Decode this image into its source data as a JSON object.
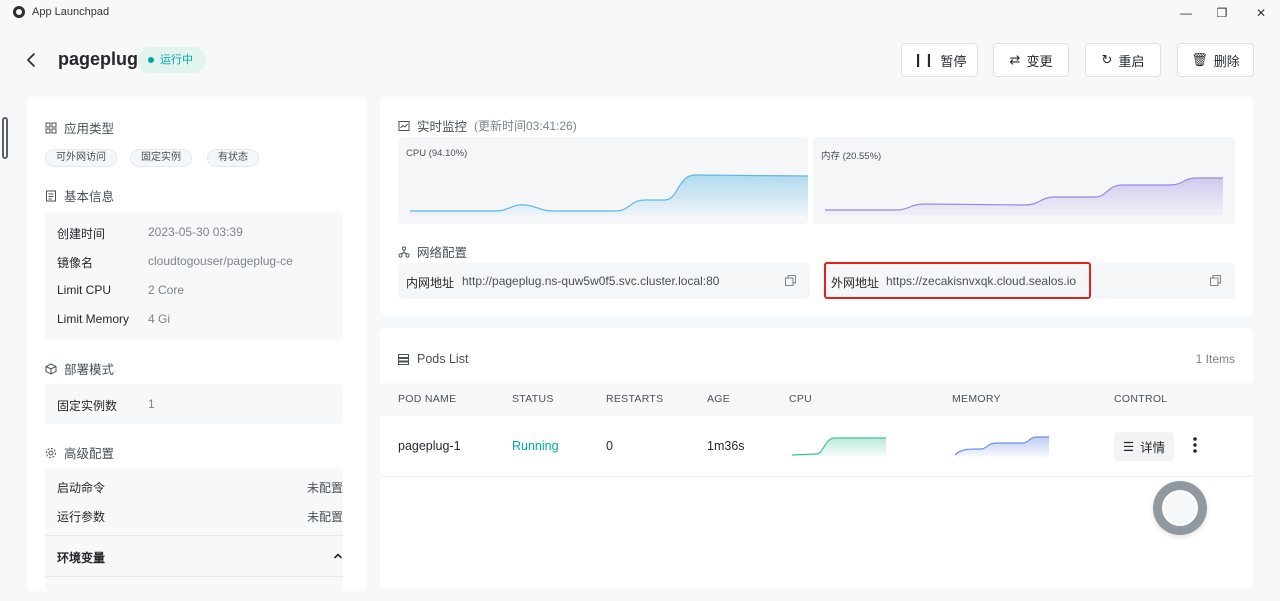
{
  "window": {
    "title": "App Launchpad",
    "minimize_label": "—",
    "maximize_label": "❐",
    "close_label": "✕"
  },
  "header": {
    "app_name": "pageplug",
    "status": "运行中",
    "actions": {
      "pause": "暂停",
      "change": "变更",
      "restart": "重启",
      "delete": "删除"
    }
  },
  "sidebar": {
    "app_type": {
      "title": "应用类型",
      "tags": [
        "可外网访问",
        "固定实例",
        "有状态"
      ]
    },
    "basic": {
      "title": "基本信息",
      "rows": [
        {
          "label": "创建时间",
          "value": "2023-05-30 03:39"
        },
        {
          "label": "镜像名",
          "value": "cloudtogouser/pageplug-ce"
        },
        {
          "label": "Limit CPU",
          "value": "2 Core"
        },
        {
          "label": "Limit Memory",
          "value": "4 Gi"
        }
      ]
    },
    "deploy": {
      "title": "部署模式",
      "label": "固定实例数",
      "value": "1"
    },
    "advanced": {
      "title": "高级配置",
      "rows": [
        {
          "label": "启动命令",
          "value": "未配置"
        },
        {
          "label": "运行参数",
          "value": "未配置"
        }
      ],
      "env_label": "环境变量"
    }
  },
  "monitor": {
    "title": "实时监控",
    "updated": "(更新时间03:41:26)",
    "cpu_label": "CPU  (94.10%)",
    "mem_label": "内存  (20.55%)",
    "cpu_color": "#5fb8e3",
    "mem_color": "#9a86e0",
    "network": {
      "title": "网络配置",
      "internal_label": "内网地址",
      "internal_url": "http://pageplug.ns-quw5w0f5.svc.cluster.local:80",
      "external_label": "外网地址",
      "external_url": "https://zecakisnvxqk.cloud.sealos.io"
    }
  },
  "pods": {
    "title": "Pods List",
    "count": "1 Items",
    "columns": [
      "POD NAME",
      "STATUS",
      "RESTARTS",
      "AGE",
      "CPU",
      "MEMORY",
      "CONTROL"
    ],
    "rows": [
      {
        "name": "pageplug-1",
        "status": "Running",
        "restarts": "0",
        "age": "1m36s",
        "detail_label": "详情"
      }
    ],
    "status_color": "#00a9a6"
  },
  "colors": {
    "accent": "#00a9a6",
    "highlight": "#e0221c"
  }
}
